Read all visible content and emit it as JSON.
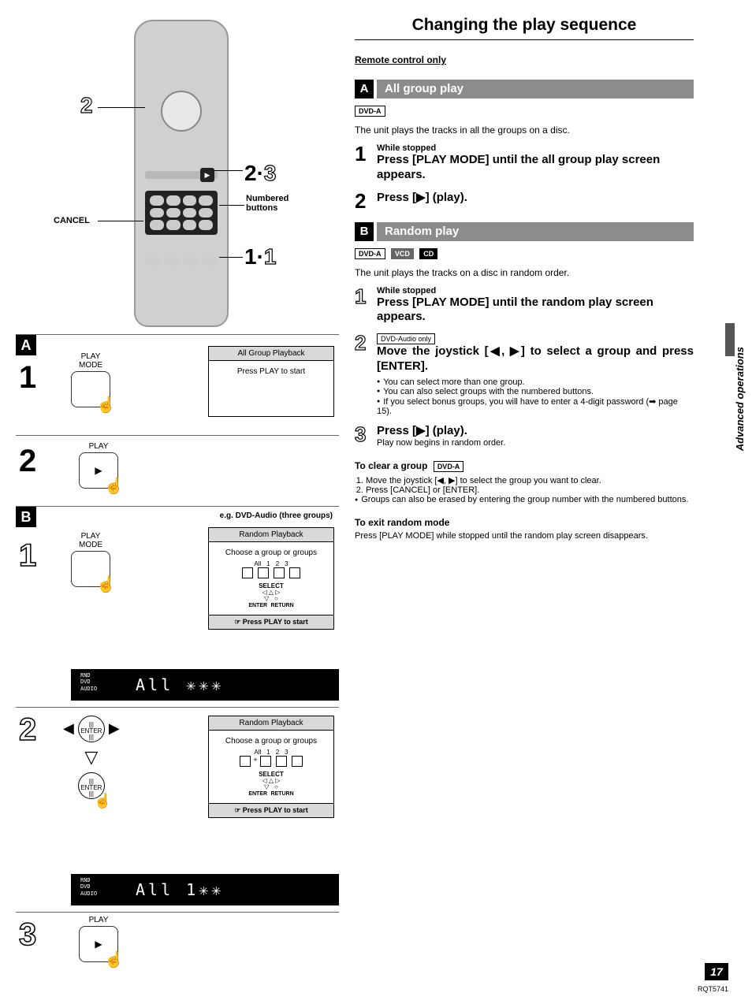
{
  "side_label": "Advanced operations",
  "page_number": "17",
  "doc_code": "RQT5741",
  "left": {
    "callouts": {
      "c2": "2",
      "c23": "2·3",
      "c11": "1·1",
      "cancel": "CANCEL",
      "numbered": "Numbered\nbuttons"
    },
    "panelA": {
      "letter": "A",
      "step": "1",
      "btn_label": "PLAY\nMODE",
      "osd_title": "All Group Playback",
      "osd_body": "Press PLAY to start"
    },
    "panelA2": {
      "step": "2",
      "btn_label": "PLAY"
    },
    "panelB": {
      "letter": "B",
      "eg": "e.g. DVD-Audio (three groups)",
      "step": "1",
      "btn_label": "PLAY\nMODE",
      "osd_title": "Random Playback",
      "osd_sub": "Choose  a group or groups",
      "groups": [
        "All",
        "1",
        "2",
        "3"
      ],
      "select": "SELECT",
      "enter": "ENTER",
      "return": "RETURN",
      "osd_foot": "☞ Press PLAY to start",
      "display_tags": "RND\nDVD\nAUDIO",
      "display_text": "All  ✳✳✳"
    },
    "panelB2": {
      "step": "2",
      "enter": "ENTER",
      "osd_title": "Random Playback",
      "osd_sub": "Choose  a group or groups",
      "groups": [
        "All",
        "1",
        "2",
        "3"
      ],
      "plus": "+",
      "select": "SELECT",
      "enter2": "ENTER",
      "return": "RETURN",
      "osd_foot": "☞ Press PLAY to start",
      "display_tags": "RND\nDVD\nAUDIO",
      "display_text": "All  1✳✳"
    },
    "panelB3": {
      "step": "3",
      "btn_label": "PLAY"
    }
  },
  "right": {
    "title": "Changing the play sequence",
    "remote_only": "Remote control only",
    "sectionA": {
      "letter": "A",
      "title": "All group play",
      "formats": [
        "DVD-A"
      ],
      "intro": "The unit plays the tracks in all the groups on a disc.",
      "steps": [
        {
          "n": "1",
          "pre": "While stopped",
          "main": "Press [PLAY MODE] until the all group play screen appears."
        },
        {
          "n": "2",
          "main": "Press [▶] (play)."
        }
      ]
    },
    "sectionB": {
      "letter": "B",
      "title": "Random play",
      "formats": [
        "DVD-A",
        "VCD",
        "CD"
      ],
      "intro": "The unit plays the tracks on a disc in random order.",
      "steps": [
        {
          "n": "1",
          "outline": true,
          "pre": "While stopped",
          "main": "Press [PLAY MODE] until the random play screen appears."
        },
        {
          "n": "2",
          "outline": true,
          "pre_box": "DVD-Audio only",
          "main": "Move the joystick [◀, ▶] to select a group and press [ENTER].",
          "bullets": [
            "You can select more than one group.",
            "You can also select groups with the numbered buttons.",
            "If you select bonus groups, you will have to enter a 4-digit password (➡ page 15)."
          ]
        },
        {
          "n": "3",
          "outline": true,
          "main": "Press [▶] (play).",
          "sub": "Play now begins in random order."
        }
      ],
      "clear": {
        "head": "To clear a group",
        "fmt": "DVD-A",
        "lines": [
          "Move the joystick [◀, ▶] to select the group you want to clear.",
          "Press [CANCEL] or [ENTER]."
        ],
        "bullet": "Groups can also be erased by entering the group number with the numbered buttons."
      },
      "exit": {
        "head": "To exit random mode",
        "body": "Press [PLAY MODE] while stopped until the random play screen disappears."
      }
    }
  }
}
